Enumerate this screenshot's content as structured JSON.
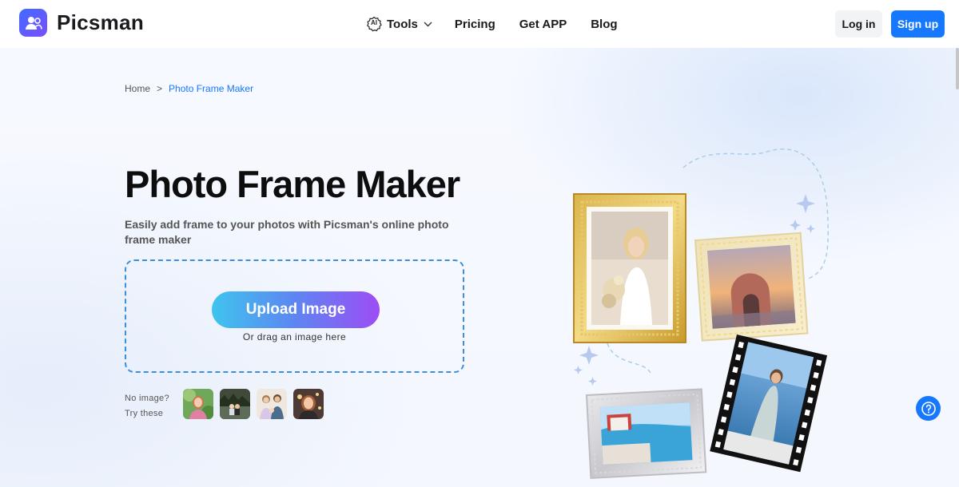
{
  "header": {
    "logo_text": "Picsman",
    "nav": {
      "tools_badge": "AI",
      "tools": "Tools",
      "pricing": "Pricing",
      "get_app": "Get APP",
      "blog": "Blog"
    },
    "login": "Log in",
    "signup": "Sign up"
  },
  "breadcrumb": {
    "home": "Home",
    "separator": ">",
    "current": "Photo Frame Maker"
  },
  "hero": {
    "title": "Photo Frame Maker",
    "subtitle": "Easily add frame to your photos with Picsman's online photo frame maker",
    "upload_button": "Upload Image",
    "drag_hint": "Or drag an image here",
    "samples_label_line1": "No image?",
    "samples_label_line2": "Try these"
  },
  "colors": {
    "accent": "#1677ff",
    "dropzone_border": "#3d8fdc",
    "upload_gradient_start": "#3fc4ee",
    "upload_gradient_end": "#9d4df4"
  },
  "icons": {
    "logo": "users-logo-icon",
    "tools": "ai-gear-icon",
    "dropdown": "chevron-down-icon",
    "help": "help-circle-icon"
  }
}
